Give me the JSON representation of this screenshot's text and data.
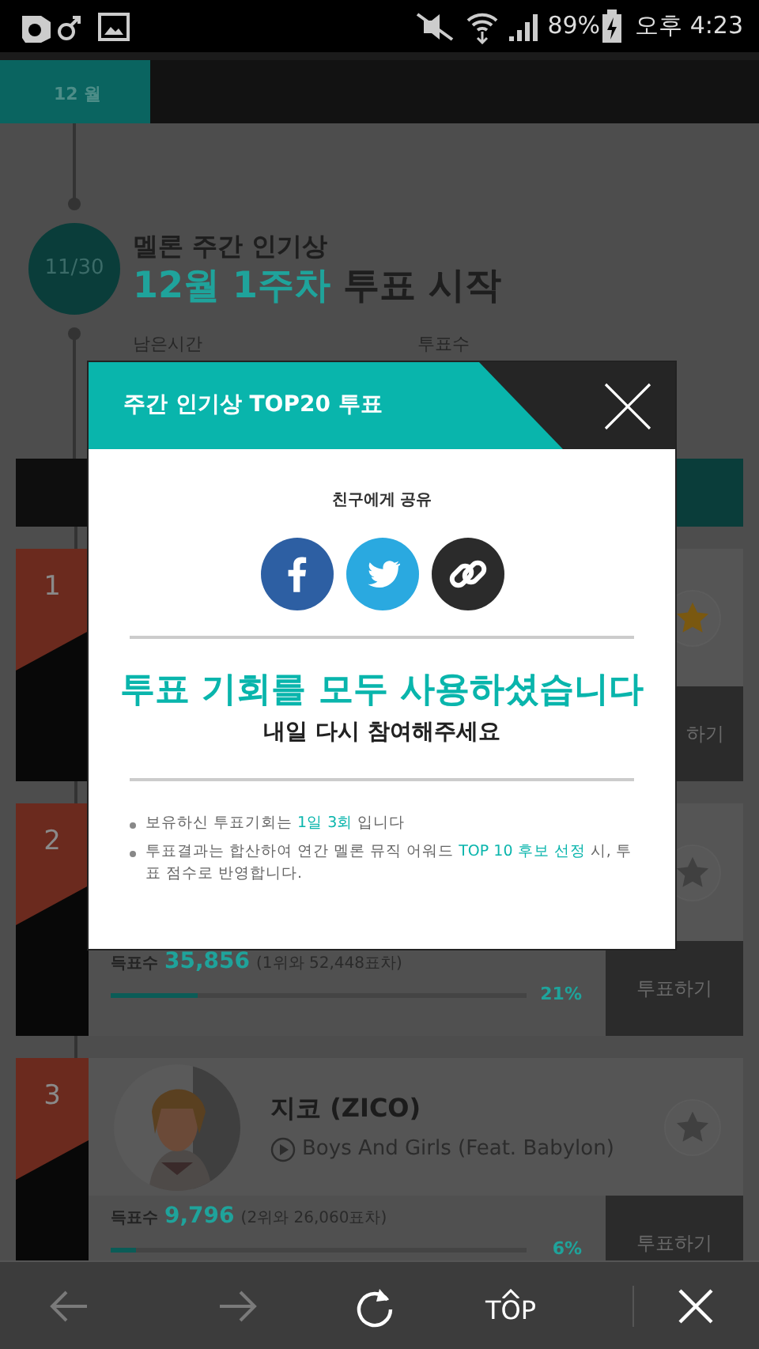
{
  "status_bar": {
    "battery": "89%",
    "time": "오후 4:23"
  },
  "month_tabs": [
    {
      "label": "12 월",
      "selected": true
    }
  ],
  "award": {
    "date": "11/30",
    "title": "멜론 주간 인기상",
    "headline_highlight": "12월 1주차",
    "headline_rest": "투표 시작",
    "remaining_label": "남은시간",
    "votes_label": "투표수"
  },
  "ranking": [
    {
      "rank": "1",
      "starred": true,
      "vote_button": "하기"
    },
    {
      "rank": "2",
      "starred": false,
      "stats": {
        "label": "득표수",
        "votes": "35,856",
        "gap": "(1위와 52,448표차)",
        "level": 0.21,
        "percent": "21%"
      },
      "vote_button": "투표하기"
    },
    {
      "rank": "3",
      "starred": false,
      "artist": "지코 (ZICO)",
      "song": "Boys And Girls (Feat. Babylon)",
      "stats": {
        "label": "득표수",
        "votes": "9,796",
        "gap": "(2위와 26,060표차)",
        "level": 0.06,
        "percent": "6%"
      },
      "vote_button": "투표하기"
    }
  ],
  "modal": {
    "title": "주간 인기상 TOP20 투표",
    "share_label": "친구에게 공유",
    "share_buttons": [
      {
        "kind": "facebook"
      },
      {
        "kind": "twitter"
      },
      {
        "kind": "link"
      }
    ],
    "message": "투표 기회를 모두 사용하셨습니다",
    "sub_message": "내일 다시 참여해주세요",
    "notes": [
      {
        "parts": [
          {
            "text": "보유하신 투표기회는 ",
            "highlight": false
          },
          {
            "text": "1일 3회",
            "highlight": true
          },
          {
            "text": " 입니다",
            "highlight": false
          }
        ]
      },
      {
        "parts": [
          {
            "text": "투표결과는 합산하여 연간 멜론 뮤직 어워드 ",
            "highlight": false
          },
          {
            "text": "TOP 10 후보 선정",
            "highlight": true
          },
          {
            "text": " 시, 투표 점수로 반영합니다.",
            "highlight": false
          }
        ]
      }
    ]
  },
  "toolbar": [
    {
      "kind": "back",
      "disabled": true
    },
    {
      "kind": "forward",
      "disabled": true
    },
    {
      "kind": "reload",
      "disabled": false
    },
    {
      "kind": "top",
      "label": "TOP",
      "disabled": false
    },
    {
      "kind": "close",
      "disabled": false
    }
  ]
}
